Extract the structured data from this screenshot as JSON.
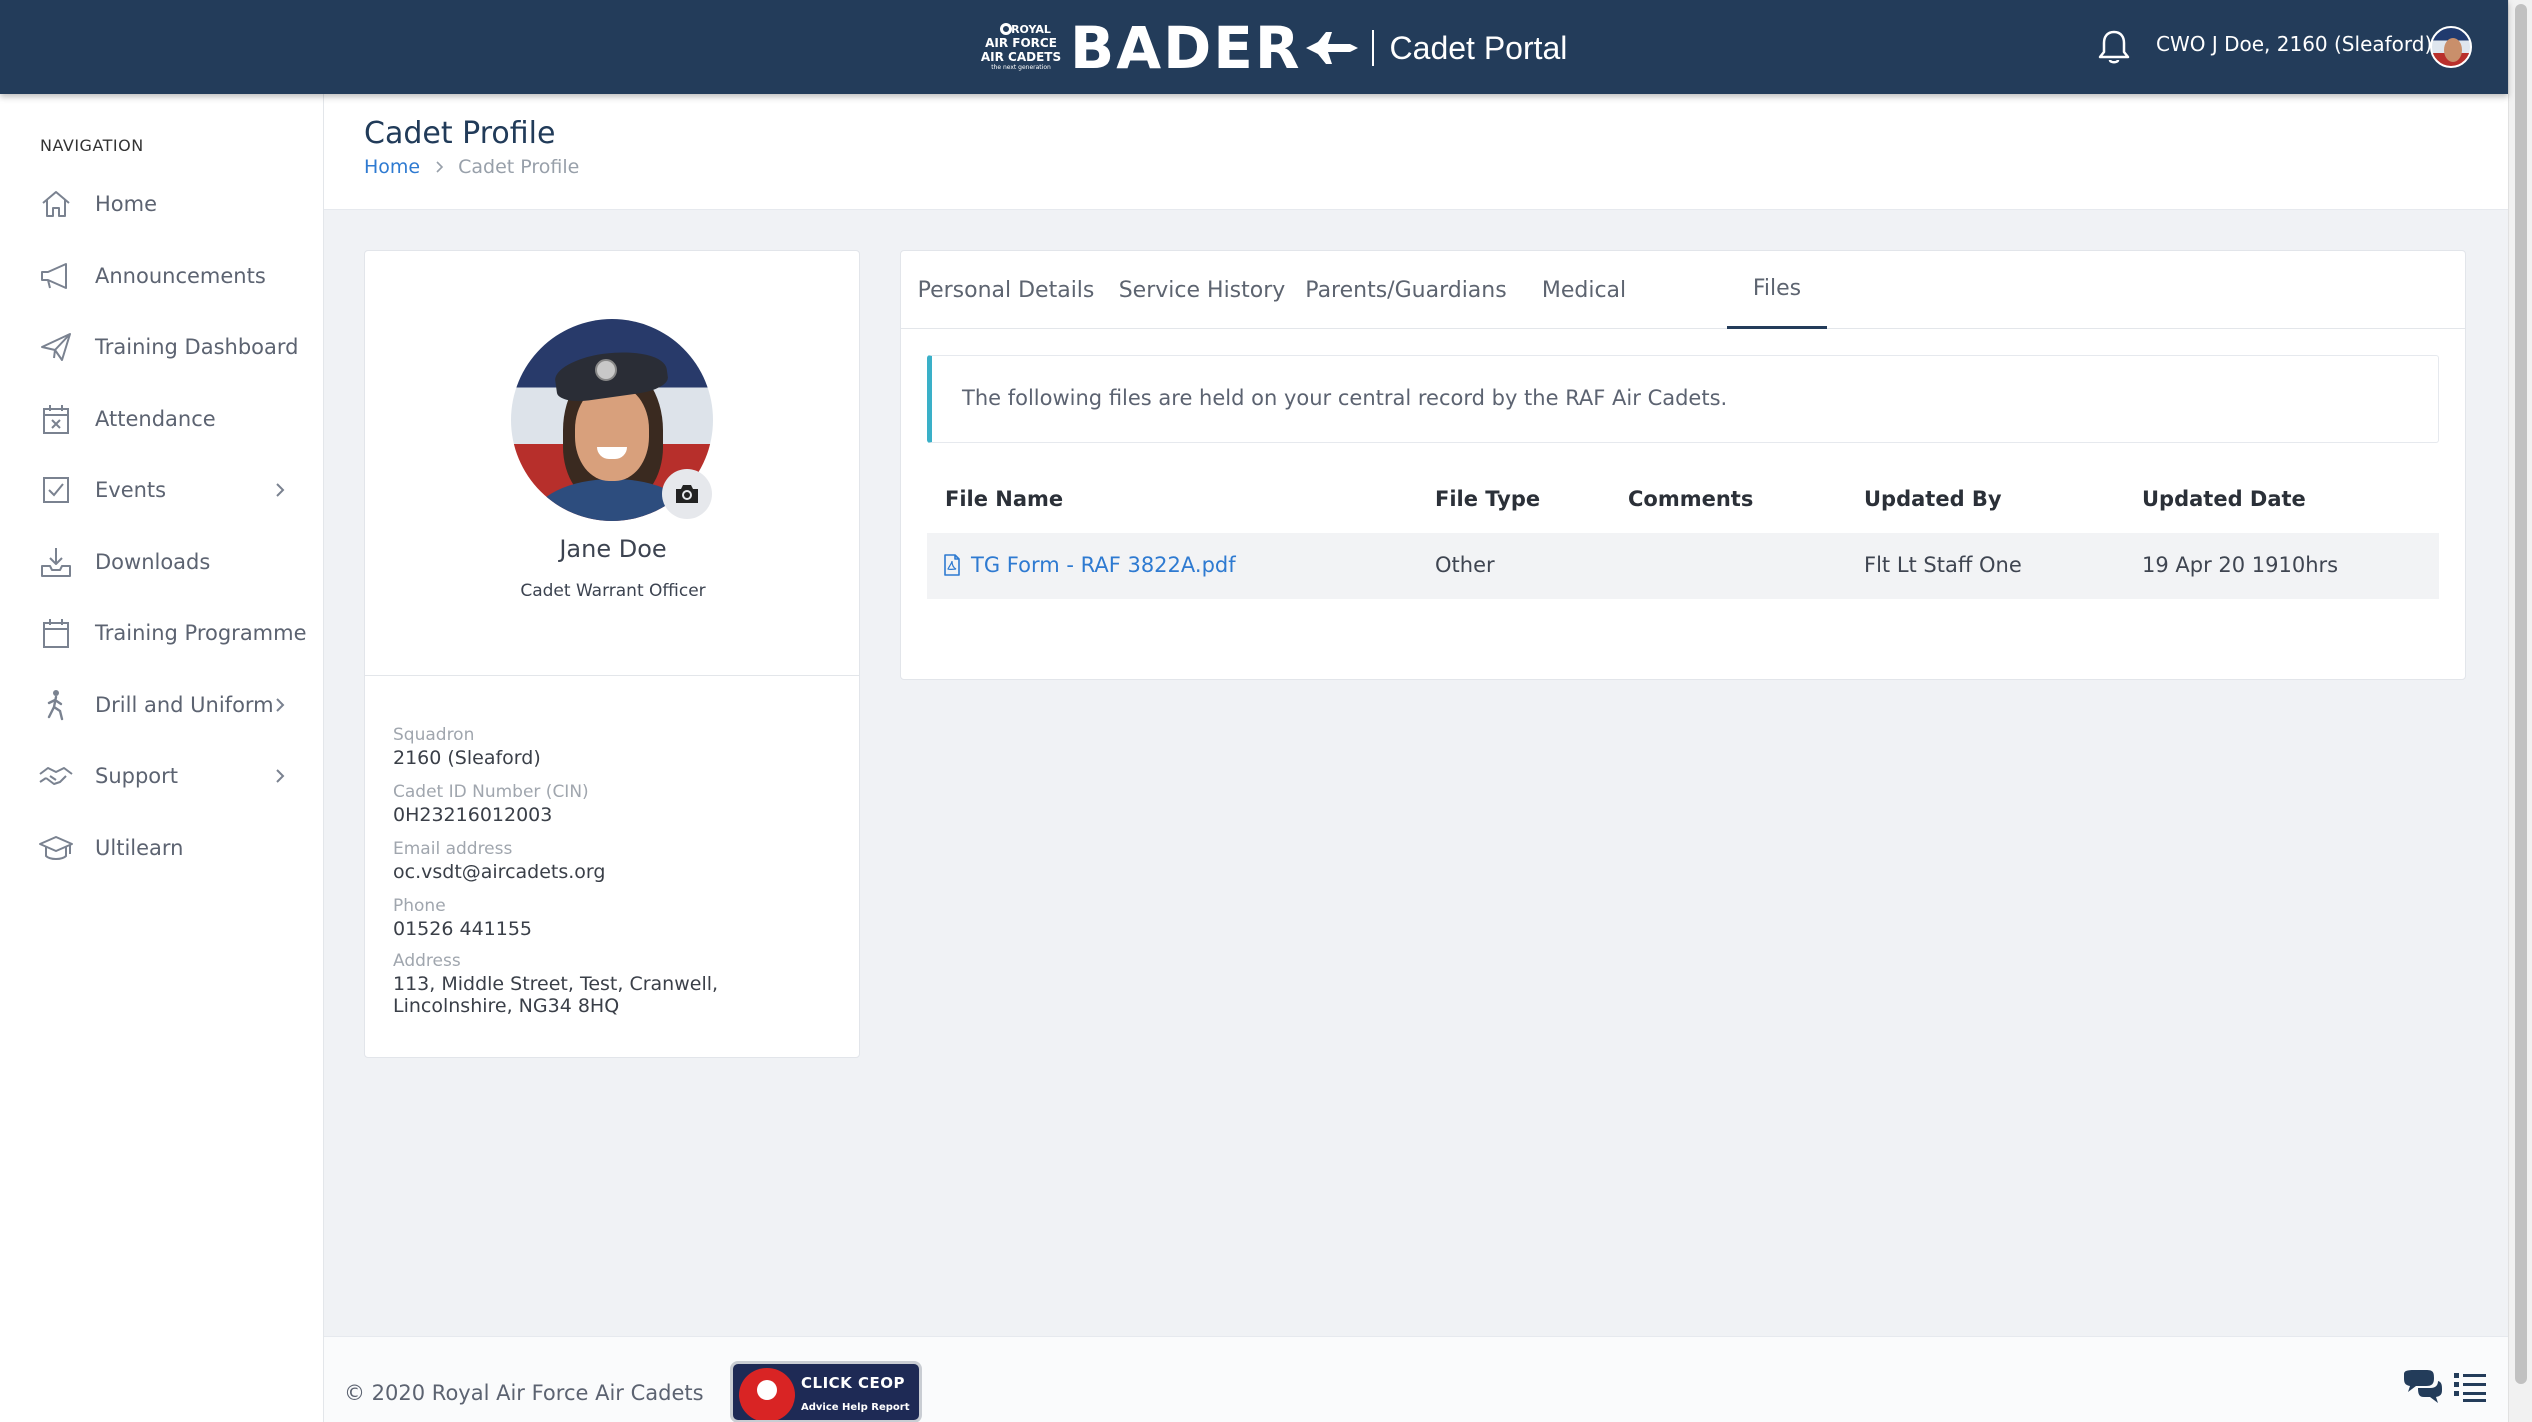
{
  "header": {
    "logo_lines": [
      "ROYAL",
      "AIR FORCE",
      "AIR CADETS",
      "the next generation"
    ],
    "brand": "BADER",
    "portal_name": "Cadet Portal",
    "user_label": "CWO J Doe, 2160 (Sleaford)",
    "icons": [
      "bell-icon",
      "jet-icon",
      "avatar"
    ]
  },
  "sidebar": {
    "heading": "NAVIGATION",
    "items": [
      {
        "label": "Home",
        "icon": "home-icon"
      },
      {
        "label": "Announcements",
        "icon": "megaphone-icon"
      },
      {
        "label": "Training Dashboard",
        "icon": "paper-plane-icon"
      },
      {
        "label": "Attendance",
        "icon": "calendar-x-icon"
      },
      {
        "label": "Events",
        "icon": "checkbox-icon",
        "expandable": true
      },
      {
        "label": "Downloads",
        "icon": "download-tray-icon"
      },
      {
        "label": "Training Programme",
        "icon": "calendar-icon"
      },
      {
        "label": "Drill and Uniform",
        "icon": "marching-icon",
        "expandable": true
      },
      {
        "label": "Support",
        "icon": "handshake-icon",
        "expandable": true
      },
      {
        "label": "Ultilearn",
        "icon": "graduation-cap-icon"
      }
    ]
  },
  "page": {
    "title": "Cadet Profile",
    "breadcrumb_home": "Home",
    "breadcrumb_current": "Cadet Profile"
  },
  "profile": {
    "name": "Jane Doe",
    "rank": "Cadet Warrant Officer",
    "details": [
      {
        "label": "Squadron",
        "value": "2160 (Sleaford)"
      },
      {
        "label": "Cadet ID Number (CIN)",
        "value": "0H23216012003"
      },
      {
        "label": "Email address",
        "value": "oc.vsdt@aircadets.org"
      },
      {
        "label": "Phone",
        "value": "01526 441155"
      },
      {
        "label": "Address",
        "value": "113, Middle Street, Test, Cranwell, Lincolnshire, NG34 8HQ"
      }
    ]
  },
  "tabs": [
    {
      "label": "Personal Details",
      "active": false
    },
    {
      "label": "Service History",
      "active": false
    },
    {
      "label": "Parents/Guardians",
      "active": false
    },
    {
      "label": "Medical",
      "active": false
    },
    {
      "label": "Files",
      "active": true
    }
  ],
  "files": {
    "info_text": "The following files are held on your central record by the RAF Air Cadets.",
    "columns": [
      "File Name",
      "File Type",
      "Comments",
      "Updated By",
      "Updated Date"
    ],
    "rows": [
      {
        "file_name": "TG Form - RAF 3822A.pdf",
        "file_type": "Other",
        "comments": "",
        "updated_by": "Flt Lt Staff One",
        "updated_date": "19 Apr 20 1910hrs"
      }
    ]
  },
  "footer": {
    "copyright": "© 2020 Royal Air Force Air Cadets",
    "ceop_title": "CLICK CEOP",
    "ceop_subtitle": "Advice Help Report"
  },
  "colors": {
    "header_bg": "#233c5a",
    "link": "#2e7ad1",
    "info_accent": "#3ab0c8",
    "page_bg": "#f0f2f5"
  }
}
